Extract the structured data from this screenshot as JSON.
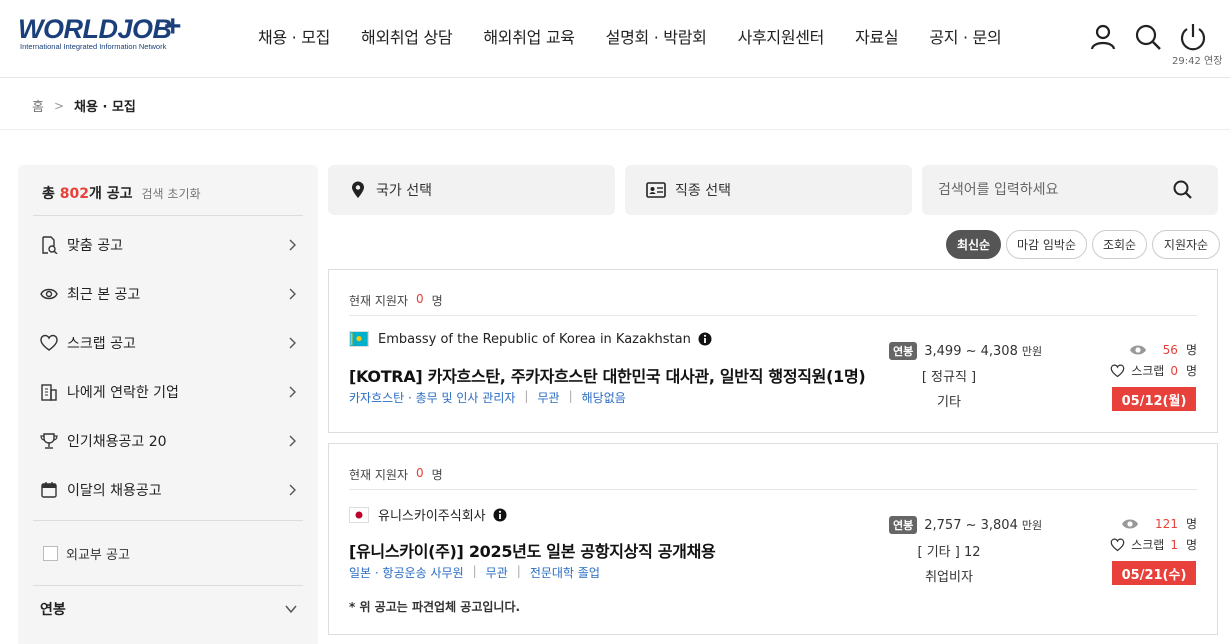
{
  "header": {
    "logo_main": "WORLDJOB",
    "logo_plus": "+",
    "logo_sub": "International Integrated Information Network",
    "nav": [
      "채용 · 모집",
      "해외취업 상담",
      "해외취업 교육",
      "설명회 · 박람회",
      "사후지원센터",
      "자료실",
      "공지 · 문의"
    ],
    "session": "29:42 연장"
  },
  "breadcrumb": {
    "home": "홈",
    "current": "채용 · 모집"
  },
  "sidebar": {
    "total_prefix": "총 ",
    "total_count": "802",
    "total_suffix": "개 공고",
    "reset": "검색 초기화",
    "items": [
      {
        "label": "맞춤 공고",
        "icon": "doc-search-icon"
      },
      {
        "label": "최근 본 공고",
        "icon": "eye-icon"
      },
      {
        "label": "스크랩 공고",
        "icon": "heart-icon"
      },
      {
        "label": "나에게 연락한 기업",
        "icon": "building-icon"
      },
      {
        "label": "인기채용공고 20",
        "icon": "trophy-icon"
      },
      {
        "label": "이달의 채용공고",
        "icon": "calendar-icon"
      }
    ],
    "checkbox_label": "외교부 공고",
    "salary_label": "연봉"
  },
  "filters": {
    "country": "국가 선택",
    "job": "직종 선택",
    "search_placeholder": "검색어를 입력하세요"
  },
  "sort": [
    "최신순",
    "마감 임박순",
    "조회순",
    "지원자순"
  ],
  "jobs": [
    {
      "applicants_label": "현재 지원자",
      "applicants": "0",
      "applicants_unit": "명",
      "company": "Embassy of the Republic of Korea in Kazakhstan",
      "title": "[KOTRA] 카자흐스탄, 주카자흐스탄 대한민국 대사관, 일반직 행정직원(1명)",
      "tags": [
        "카자흐스탄 · 총무 및 인사 관리자",
        "무관",
        "해당없음"
      ],
      "salary_badge": "연봉",
      "salary": "3,499 ~ 4,308",
      "salary_unit": "만원",
      "employment": "[ 정규직 ]",
      "visa": "기타",
      "views": "56",
      "scrap_label": "스크랩",
      "scraps": "0",
      "count_unit": "명",
      "deadline": "05/12(월)"
    },
    {
      "applicants_label": "현재 지원자",
      "applicants": "0",
      "applicants_unit": "명",
      "company": "유니스카이주식회사",
      "title": "[유니스카이(주)] 2025년도 일본 공항지상직 공개채용",
      "tags": [
        "일본 · 항공운송 사무원",
        "무관",
        "전문대학 졸업"
      ],
      "salary_badge": "연봉",
      "salary": "2,757 ~ 3,804",
      "salary_unit": "만원",
      "employment": "[ 기타 ] 12",
      "visa": "취업비자",
      "views": "121",
      "scrap_label": "스크랩",
      "scraps": "1",
      "count_unit": "명",
      "deadline": "05/21(수)",
      "note": "* 위 공고는 파견업체 공고입니다."
    }
  ]
}
